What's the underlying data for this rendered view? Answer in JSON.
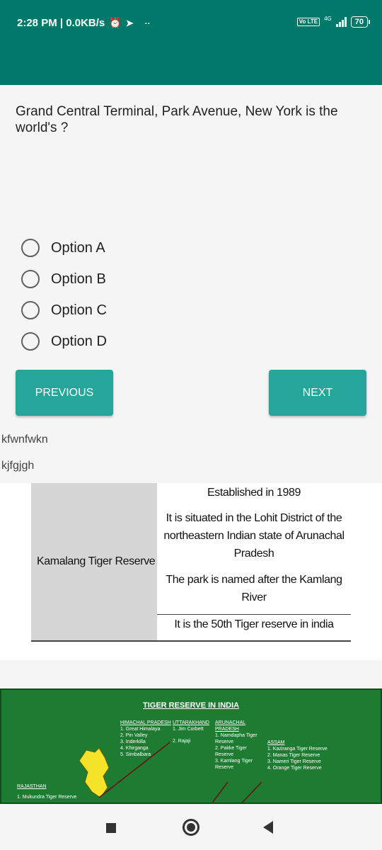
{
  "status_bar": {
    "time_speed": "2:28 PM | 0.0KB/s",
    "volte": "Vo LTE",
    "network": "4G",
    "battery": "70"
  },
  "quiz": {
    "question": "Grand Central Terminal, Park Avenue, New York is the world's ?",
    "options": [
      "Option A",
      "Option B",
      "Option C",
      "Option D"
    ],
    "previous_label": "PREVIOUS",
    "next_label": "NEXT"
  },
  "debug_lines": [
    "kfwnfwkn",
    "kjfgjgh"
  ],
  "info_image": {
    "name": "Kamalang Tiger Reserve",
    "facts": [
      "Established in 1989",
      "It is situated in the Lohit District of the northeastern Indian state of Arunachal Pradesh",
      "The park is named after the Kamlang River",
      "It is the 50th Tiger reserve in india"
    ]
  },
  "map_image": {
    "title": "TIGER RESERVE IN INDIA",
    "himachal": {
      "header": "HIMACHAL PRADESH",
      "items": [
        "1. Great Himalaya",
        "2. Pin Valley",
        "3. Inderkilla",
        "4. Khirganga",
        "5. Simbalbara"
      ]
    },
    "uttarakhand": {
      "header": "UTTARAKHAND",
      "items": [
        "1. Jim Corbett",
        "2. Rajaji"
      ]
    },
    "arunachal": {
      "header": "ARUNACHAL PRADESH",
      "items": [
        "1. Namdapha Tiger Reserve",
        "2. Pakke Tiger Reserve",
        "3. Kamlang Tiger Reserve"
      ]
    },
    "assam": {
      "header": "ASSAM",
      "items": [
        "1. Kaziranga Tiger Reserve",
        "2. Manas Tiger Reserve",
        "3. Nameri Tiger Reserve",
        "4. Orange Tiger Reserve"
      ]
    },
    "rajasthan": {
      "header": "RAJASTHAN",
      "items": [
        "1. Mukundra Tiger Reserve"
      ]
    }
  }
}
